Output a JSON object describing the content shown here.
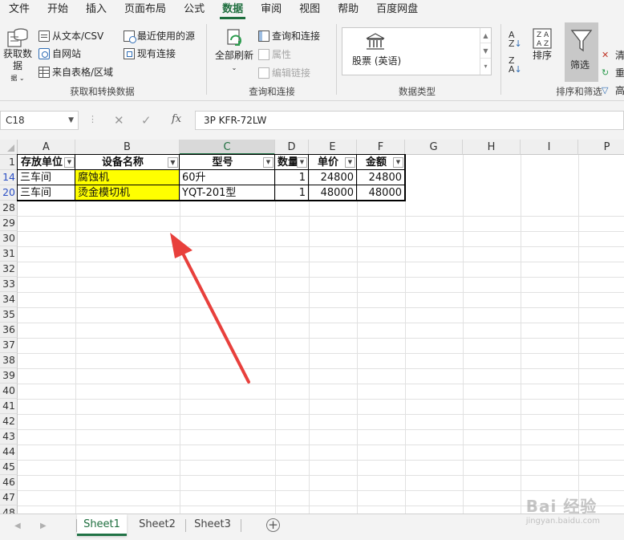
{
  "menu": {
    "tabs": [
      "文件",
      "开始",
      "插入",
      "页面布局",
      "公式",
      "数据",
      "审阅",
      "视图",
      "帮助",
      "百度网盘"
    ],
    "active": "数据"
  },
  "ribbon": {
    "get_data": {
      "big_button": "获取数据",
      "from_text_csv": "从文本/CSV",
      "from_web": "自网站",
      "from_table": "来自表格/区域",
      "recent_sources": "最近使用的源",
      "existing_connections": "现有连接",
      "group_label": "获取和转换数据"
    },
    "queries": {
      "refresh_all": "全部刷新",
      "queries_connections": "查询和连接",
      "properties": "属性",
      "edit_links": "编辑链接",
      "group_label": "查询和连接"
    },
    "data_types": {
      "stocks": "股票 (英语)",
      "group_label": "数据类型"
    },
    "sort_filter": {
      "sort": "排序",
      "filter": "筛选",
      "clear": "清",
      "reapply": "重",
      "advanced": "高",
      "group_label": "排序和筛选"
    }
  },
  "formula_bar": {
    "name_box": "C18",
    "formula": "3P KFR-72LW",
    "fx": "fx"
  },
  "grid": {
    "columns": [
      "A",
      "B",
      "C",
      "D",
      "E",
      "F",
      "G",
      "H",
      "I",
      "P"
    ],
    "selected_column": "C",
    "rows": [
      "1",
      "14",
      "20",
      "28",
      "29",
      "30",
      "31",
      "32",
      "33",
      "34",
      "35",
      "36",
      "37",
      "38",
      "39",
      "40",
      "41",
      "42",
      "43",
      "44",
      "45",
      "46",
      "47",
      "48"
    ],
    "headers": [
      "存放单位",
      "设备名称",
      "型号",
      "数量",
      "单价",
      "金额"
    ],
    "data_rows": [
      {
        "row": "14",
        "a": "三车间",
        "b": "腐蚀机",
        "c": "60升",
        "d": "1",
        "e": "24800",
        "f": "24800"
      },
      {
        "row": "20",
        "a": "三车间",
        "b": "烫金模切机",
        "c": "YQT-201型",
        "d": "1",
        "e": "48000",
        "f": "48000"
      }
    ],
    "highlight_color": "#ffff00",
    "annotation_color": "#e8403c"
  },
  "sheets": {
    "tabs": [
      "Sheet1",
      "Sheet2",
      "Sheet3"
    ],
    "active": "Sheet1",
    "add": "+"
  },
  "watermark": {
    "main": "Bai 经验",
    "sub": "jingyan.baidu.com"
  }
}
